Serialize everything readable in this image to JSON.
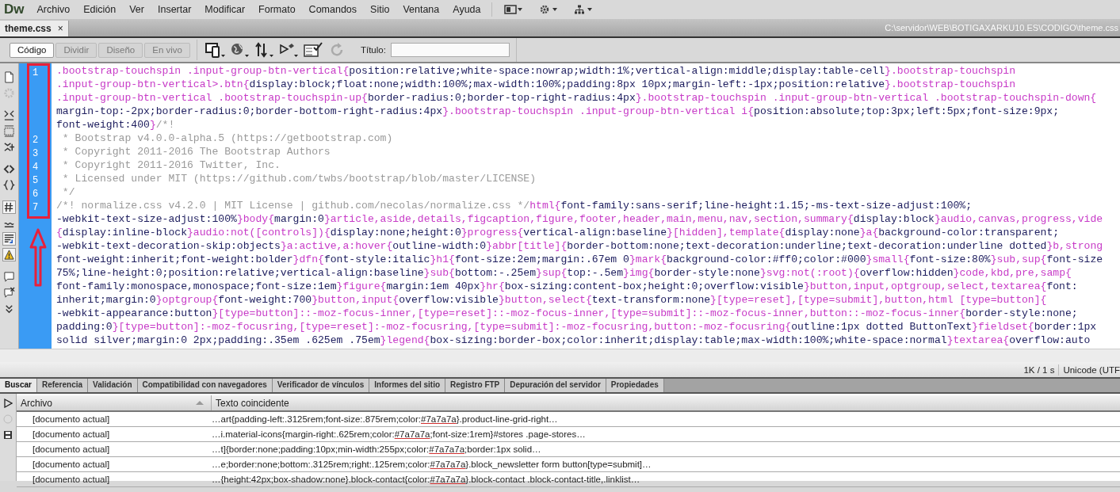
{
  "app": {
    "logo": "Dw"
  },
  "menu": [
    "Archivo",
    "Edición",
    "Ver",
    "Insertar",
    "Modificar",
    "Formato",
    "Comandos",
    "Sitio",
    "Ventana",
    "Ayuda"
  ],
  "document_tabs": [
    {
      "label": "theme.css",
      "close": "×",
      "selected": true
    }
  ],
  "file_path": "C:\\servidor\\WEB\\BOTIGAXARKU10.ES\\CODIGO\\theme.css",
  "view_buttons": [
    {
      "label": "Código",
      "selected": true,
      "disabled": false
    },
    {
      "label": "Dividir",
      "selected": false,
      "disabled": true
    },
    {
      "label": "Diseño",
      "selected": false,
      "disabled": true
    },
    {
      "label": "En vivo",
      "selected": false,
      "disabled": true
    }
  ],
  "title_field": {
    "label": "Título:"
  },
  "code_lines": [
    {
      "number": "1",
      "segments": [
        {
          "kind": "selector",
          "text": ".bootstrap-touchspin .input-group-btn-vertical{"
        },
        {
          "kind": "property",
          "text": "position:relative;white-space:nowrap;width:1%;vertical-align:middle;display:table-cell"
        },
        {
          "kind": "selector",
          "text": "}.bootstrap-touchspin"
        }
      ]
    },
    {
      "segments": [
        {
          "kind": "selector",
          "text": ".input-group-btn-vertical>.btn{"
        },
        {
          "kind": "property",
          "text": "display:block;float:none;width:100%;max-width:100%;padding:8px 10px;margin-left:-1px;position:relative"
        },
        {
          "kind": "selector",
          "text": "}.bootstrap-touchspin"
        }
      ]
    },
    {
      "segments": [
        {
          "kind": "selector",
          "text": ".input-group-btn-vertical .bootstrap-touchspin-up{"
        },
        {
          "kind": "property",
          "text": "border-radius:0;border-top-right-radius:4px"
        },
        {
          "kind": "selector",
          "text": "}.bootstrap-touchspin .input-group-btn-vertical .bootstrap-touchspin-down{"
        }
      ]
    },
    {
      "segments": [
        {
          "kind": "property",
          "text": "margin-top:-2px;border-radius:0;border-bottom-right-radius:4px"
        },
        {
          "kind": "selector",
          "text": "}.bootstrap-touchspin .input-group-btn-vertical i{"
        },
        {
          "kind": "property",
          "text": "position:absolute;top:3px;left:5px;font-size:9px;"
        }
      ]
    },
    {
      "segments": [
        {
          "kind": "property",
          "text": "font-weight:400"
        },
        {
          "kind": "selector",
          "text": "}"
        },
        {
          "kind": "comment",
          "text": "/*!"
        }
      ]
    },
    {
      "number": "2",
      "segments": [
        {
          "kind": "comment",
          "text": " * Bootstrap v4.0.0-alpha.5 (https://getbootstrap.com)"
        }
      ]
    },
    {
      "number": "3",
      "segments": [
        {
          "kind": "comment",
          "text": " * Copyright 2011-2016 The Bootstrap Authors"
        }
      ]
    },
    {
      "number": "4",
      "segments": [
        {
          "kind": "comment",
          "text": " * Copyright 2011-2016 Twitter, Inc."
        }
      ]
    },
    {
      "number": "5",
      "segments": [
        {
          "kind": "comment",
          "text": " * Licensed under MIT (https://github.com/twbs/bootstrap/blob/master/LICENSE)"
        }
      ]
    },
    {
      "number": "6",
      "segments": [
        {
          "kind": "comment",
          "text": " */"
        }
      ]
    },
    {
      "number": "7",
      "segments": [
        {
          "kind": "comment",
          "text": "/*! normalize.css v4.2.0 | MIT License | github.com/necolas/normalize.css */"
        },
        {
          "kind": "selector",
          "text": "html{"
        },
        {
          "kind": "property",
          "text": "font-family:sans-serif;line-height:1.15;-ms-text-size-adjust:100%;"
        }
      ]
    },
    {
      "segments": [
        {
          "kind": "property",
          "text": "-webkit-text-size-adjust:100%"
        },
        {
          "kind": "selector",
          "text": "}body{"
        },
        {
          "kind": "property",
          "text": "margin:0"
        },
        {
          "kind": "selector",
          "text": "}article,aside,details,figcaption,figure,footer,header,main,menu,nav,section,summary{"
        },
        {
          "kind": "property",
          "text": "display:block"
        },
        {
          "kind": "selector",
          "text": "}audio,canvas,progress,vide"
        }
      ]
    },
    {
      "segments": [
        {
          "kind": "selector",
          "text": "{"
        },
        {
          "kind": "property",
          "text": "display:inline-block"
        },
        {
          "kind": "selector",
          "text": "}audio:not([controls]){"
        },
        {
          "kind": "property",
          "text": "display:none;height:0"
        },
        {
          "kind": "selector",
          "text": "}progress{"
        },
        {
          "kind": "property",
          "text": "vertical-align:baseline"
        },
        {
          "kind": "selector",
          "text": "}[hidden],template{"
        },
        {
          "kind": "property",
          "text": "display:none"
        },
        {
          "kind": "selector",
          "text": "}a{"
        },
        {
          "kind": "property",
          "text": "background-color:transparent;"
        }
      ]
    },
    {
      "segments": [
        {
          "kind": "property",
          "text": "-webkit-text-decoration-skip:objects"
        },
        {
          "kind": "selector",
          "text": "}a:active,a:hover{"
        },
        {
          "kind": "property",
          "text": "outline-width:0"
        },
        {
          "kind": "selector",
          "text": "}abbr[title]{"
        },
        {
          "kind": "property",
          "text": "border-bottom:none;text-decoration:underline;text-decoration:underline dotted"
        },
        {
          "kind": "selector",
          "text": "}b,strong"
        }
      ]
    },
    {
      "segments": [
        {
          "kind": "property",
          "text": "font-weight:inherit;font-weight:bolder"
        },
        {
          "kind": "selector",
          "text": "}dfn{"
        },
        {
          "kind": "property",
          "text": "font-style:italic"
        },
        {
          "kind": "selector",
          "text": "}h1{"
        },
        {
          "kind": "property",
          "text": "font-size:2em;margin:.67em 0"
        },
        {
          "kind": "selector",
          "text": "}mark{"
        },
        {
          "kind": "property",
          "text": "background-color:#ff0;color:#000"
        },
        {
          "kind": "selector",
          "text": "}small{"
        },
        {
          "kind": "property",
          "text": "font-size:80%"
        },
        {
          "kind": "selector",
          "text": "}sub,sup{"
        },
        {
          "kind": "property",
          "text": "font-size"
        }
      ]
    },
    {
      "segments": [
        {
          "kind": "property",
          "text": "75%;line-height:0;position:relative;vertical-align:baseline"
        },
        {
          "kind": "selector",
          "text": "}sub{"
        },
        {
          "kind": "property",
          "text": "bottom:-.25em"
        },
        {
          "kind": "selector",
          "text": "}sup{"
        },
        {
          "kind": "property",
          "text": "top:-.5em"
        },
        {
          "kind": "selector",
          "text": "}img{"
        },
        {
          "kind": "property",
          "text": "border-style:none"
        },
        {
          "kind": "selector",
          "text": "}svg:not(:root){"
        },
        {
          "kind": "property",
          "text": "overflow:hidden"
        },
        {
          "kind": "selector",
          "text": "}code,kbd,pre,samp{"
        }
      ]
    },
    {
      "segments": [
        {
          "kind": "property",
          "text": "font-family:monospace,monospace;font-size:1em"
        },
        {
          "kind": "selector",
          "text": "}figure{"
        },
        {
          "kind": "property",
          "text": "margin:1em 40px"
        },
        {
          "kind": "selector",
          "text": "}hr{"
        },
        {
          "kind": "property",
          "text": "box-sizing:content-box;height:0;overflow:visible"
        },
        {
          "kind": "selector",
          "text": "}button,input,optgroup,select,textarea{"
        },
        {
          "kind": "property",
          "text": "font:"
        }
      ]
    },
    {
      "segments": [
        {
          "kind": "property",
          "text": "inherit;margin:0"
        },
        {
          "kind": "selector",
          "text": "}optgroup{"
        },
        {
          "kind": "property",
          "text": "font-weight:700"
        },
        {
          "kind": "selector",
          "text": "}button,input{"
        },
        {
          "kind": "property",
          "text": "overflow:visible"
        },
        {
          "kind": "selector",
          "text": "}button,select{"
        },
        {
          "kind": "property",
          "text": "text-transform:none"
        },
        {
          "kind": "selector",
          "text": "}[type=reset],[type=submit],button,html [type=button]{"
        }
      ]
    },
    {
      "segments": [
        {
          "kind": "property",
          "text": "-webkit-appearance:button"
        },
        {
          "kind": "selector",
          "text": "}[type=button]::-moz-focus-inner,[type=reset]::-moz-focus-inner,[type=submit]::-moz-focus-inner,button::-moz-focus-inner{"
        },
        {
          "kind": "property",
          "text": "border-style:none;"
        }
      ]
    },
    {
      "segments": [
        {
          "kind": "property",
          "text": "padding:0"
        },
        {
          "kind": "selector",
          "text": "}[type=button]:-moz-focusring,[type=reset]:-moz-focusring,[type=submit]:-moz-focusring,button:-moz-focusring{"
        },
        {
          "kind": "property",
          "text": "outline:1px dotted ButtonText"
        },
        {
          "kind": "selector",
          "text": "}fieldset{"
        },
        {
          "kind": "property",
          "text": "border:1px"
        }
      ]
    },
    {
      "segments": [
        {
          "kind": "property",
          "text": "solid silver;margin:0 2px;padding:.35em .625em .75em"
        },
        {
          "kind": "selector",
          "text": "}legend{"
        },
        {
          "kind": "property",
          "text": "box-sizing:border-box;color:inherit;display:table;max-width:100%;white-space:normal"
        },
        {
          "kind": "selector",
          "text": "}textarea{"
        },
        {
          "kind": "property",
          "text": "overflow:auto"
        }
      ]
    }
  ],
  "status_bar": {
    "size": "1K / 1 s",
    "encoding": "Unicode (UTF"
  },
  "panel_tabs": [
    {
      "label": "Buscar",
      "selected": true
    },
    {
      "label": "Referencia",
      "selected": false
    },
    {
      "label": "Validación",
      "selected": false
    },
    {
      "label": "Compatibilidad con navegadores",
      "selected": false
    },
    {
      "label": "Verificador de vínculos",
      "selected": false
    },
    {
      "label": "Informes del sitio",
      "selected": false
    },
    {
      "label": "Registro FTP",
      "selected": false
    },
    {
      "label": "Depuración del servidor",
      "selected": false
    },
    {
      "label": "Propiedades",
      "selected": false
    }
  ],
  "results": {
    "columns": [
      "Archivo",
      "Texto coincidente"
    ],
    "rows": [
      {
        "file": "[documento actual]",
        "before": "…art{padding-left:.3125rem;font-size:.875rem;color:",
        "match": "#7a7a7a",
        "after": "}.product-line-grid-right…"
      },
      {
        "file": "[documento actual]",
        "before": "…i.material-icons{margin-right:.625rem;color:",
        "match": "#7a7a7a",
        "after": ";font-size:1rem}#stores .page-stores…"
      },
      {
        "file": "[documento actual]",
        "before": "…t]{border:none;padding:10px;min-width:255px;color:",
        "match": "#7a7a7a",
        "after": ";border:1px solid…"
      },
      {
        "file": "[documento actual]",
        "before": "…e;border:none;bottom:.3125rem;right:.125rem;color:",
        "match": "#7a7a7a",
        "after": "}.block_newsletter form button[type=submit]…"
      },
      {
        "file": "[documento actual]",
        "before": "…{height:42px;box-shadow:none}.block-contact{color:",
        "match": "#7a7a7a",
        "after": "}.block-contact .block-contact-title,.linklist…"
      }
    ]
  }
}
